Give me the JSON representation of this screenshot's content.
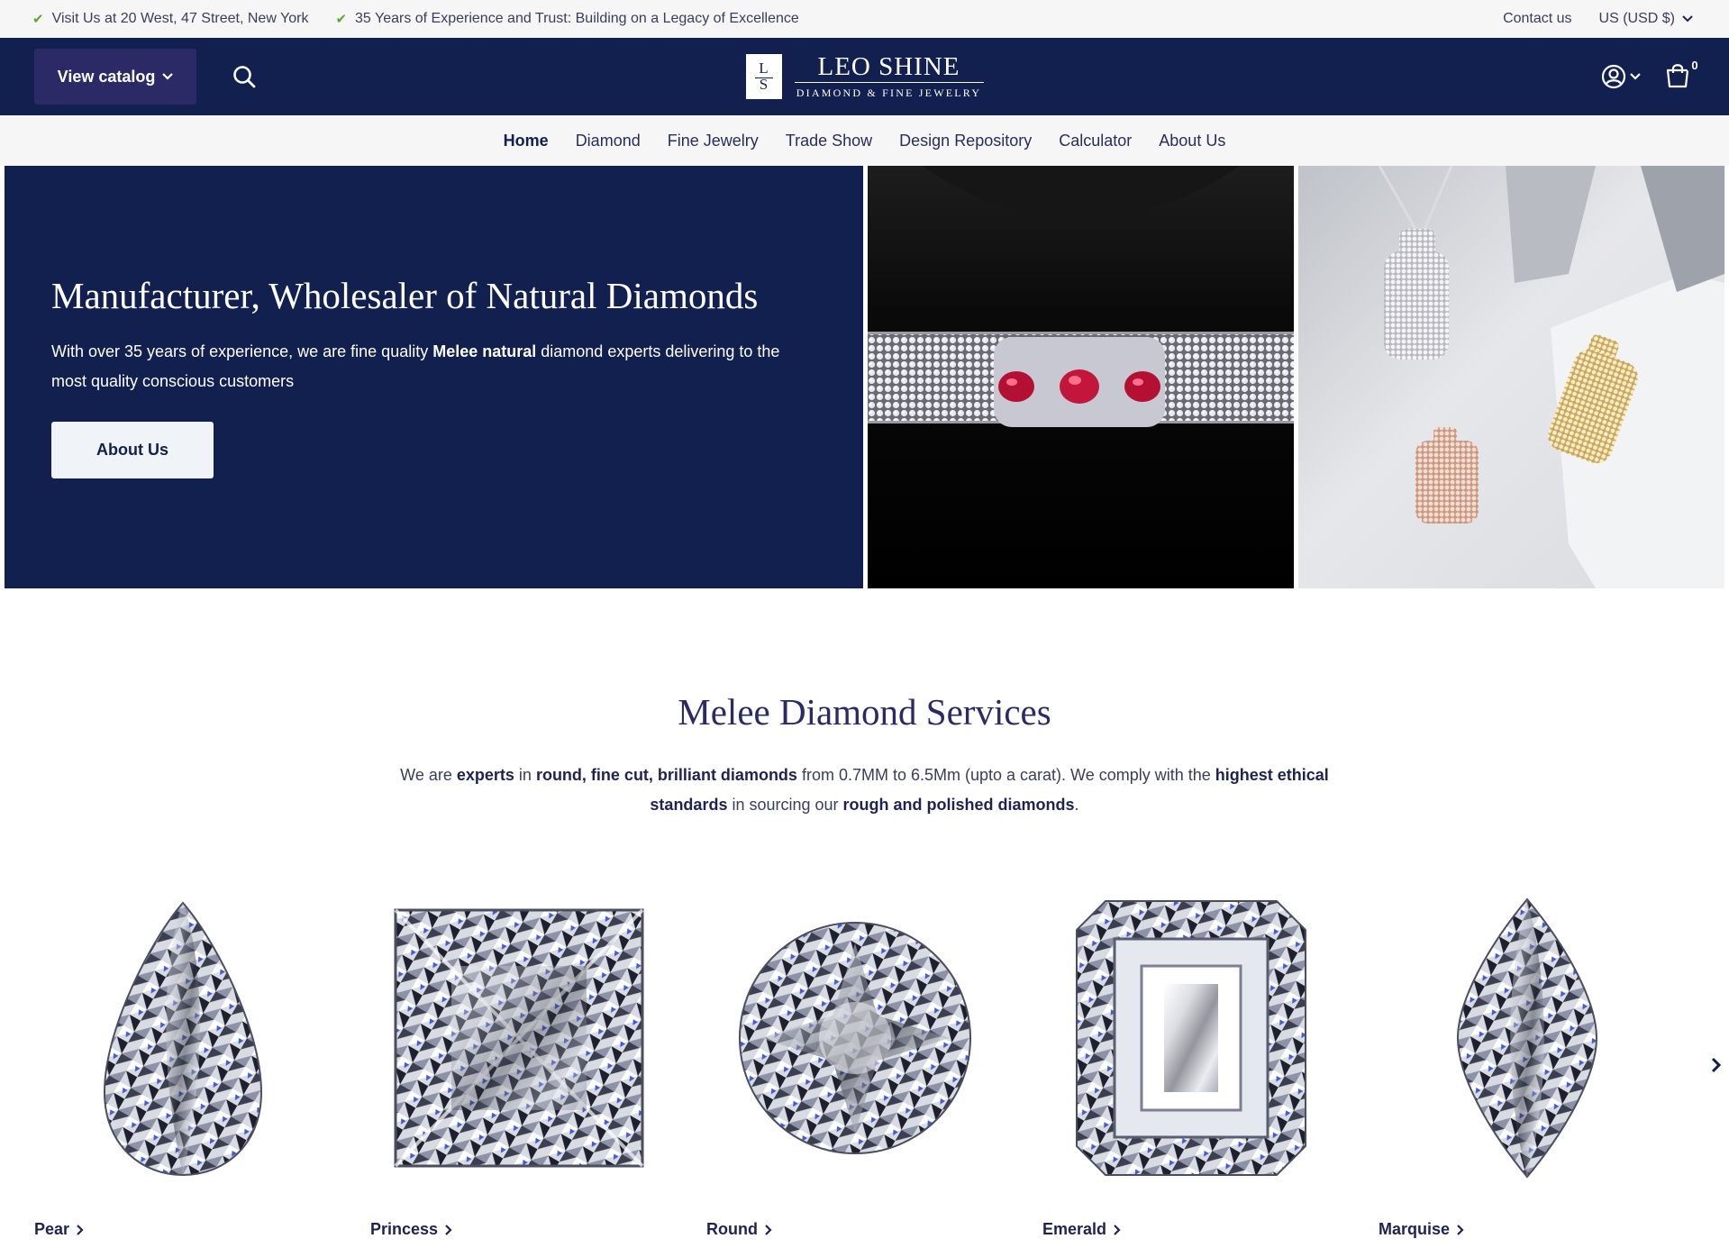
{
  "announcement": {
    "items": [
      {
        "text": "Visit Us at 20 West, 47 Street, New York",
        "icon": "check-icon"
      },
      {
        "text": "35 Years of Experience and Trust: Building on a Legacy of Excellence",
        "icon": "check-icon"
      }
    ],
    "contact_label": "Contact us",
    "currency_label": "US (USD $)"
  },
  "header": {
    "catalog_label": "View catalog",
    "logo": {
      "mark_top": "L",
      "mark_bottom": "S",
      "name": "LEO SHINE",
      "tagline": "DIAMOND & FINE JEWELRY"
    },
    "cart_count": "0"
  },
  "nav": {
    "items": [
      {
        "label": "Home",
        "active": true
      },
      {
        "label": "Diamond"
      },
      {
        "label": "Fine Jewelry"
      },
      {
        "label": "Trade Show"
      },
      {
        "label": "Design Repository"
      },
      {
        "label": "Calculator"
      },
      {
        "label": "About Us"
      }
    ]
  },
  "hero": {
    "title": "Manufacturer, Wholesaler of Natural Diamonds",
    "desc_before": "With over 35 years of experience, we are fine quality ",
    "desc_bold": "Melee natural",
    "desc_after": " diamond experts delivering to the most quality conscious customers",
    "button_label": "About Us"
  },
  "melee": {
    "title": "Melee Diamond Services",
    "desc_parts": [
      {
        "t": "We are ",
        "b": false
      },
      {
        "t": "experts",
        "b": true
      },
      {
        "t": " in ",
        "b": false
      },
      {
        "t": "round, fine cut, brilliant diamonds",
        "b": true
      },
      {
        "t": " from 0.7MM to 6.5Mm (upto a carat). We comply with the ",
        "b": false
      },
      {
        "t": "highest ethical standards",
        "b": true
      },
      {
        "t": " in sourcing our ",
        "b": false
      },
      {
        "t": "rough and polished diamonds",
        "b": true
      },
      {
        "t": ".",
        "b": false
      }
    ]
  },
  "shapes": {
    "items": [
      {
        "label": "Pear"
      },
      {
        "label": "Princess"
      },
      {
        "label": "Round"
      },
      {
        "label": "Emerald"
      },
      {
        "label": "Marquise"
      }
    ]
  },
  "colors": {
    "navy": "#12204f",
    "catalog_button": "#2b2a66",
    "check": "#5aa832",
    "background_light": "#f6f6f6"
  }
}
